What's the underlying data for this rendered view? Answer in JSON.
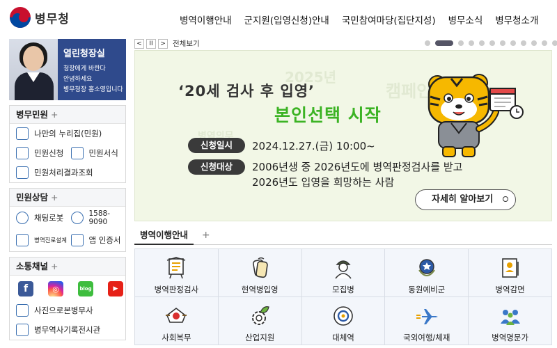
{
  "header": {
    "logo_text": "병무청",
    "nav": [
      "병역이행안내",
      "군지원(입영신청)안내",
      "국민참여마당(집단지성)",
      "병무소식",
      "병무청소개"
    ]
  },
  "ceo": {
    "title": "열린청장실",
    "sub": [
      "청장에게 바란다",
      "안녕하세요",
      "병무청장 홍소영입니다"
    ]
  },
  "civil": {
    "title": "병무민원",
    "plus": "+",
    "items": {
      "home": "나만의 누리집(민원)",
      "apply": "민원신청",
      "form": "민원서식",
      "result": "민원처리결과조회"
    }
  },
  "consult": {
    "title": "민원상담",
    "plus": "+",
    "chatbot": "채팅로봇",
    "phone": "1588-9090",
    "design": "병역진로설계",
    "app": "앱 인증서"
  },
  "sns": {
    "title": "소통채널",
    "plus": "+",
    "facebook": "f",
    "instagram": "◎",
    "blog": "blog",
    "youtube": "▶",
    "photo": "사진으로본병무사",
    "archive": "병무역사기록전시관"
  },
  "banner_controls": {
    "prev": "<",
    "pause": "II",
    "next": ">",
    "view_all": "전체보기",
    "dots": 14,
    "active_dot": 1
  },
  "banner": {
    "title": "‘20세 검사 후 입영’",
    "main": "본인선택 시작",
    "label1": "신청일시",
    "line1": "2024.12.27.(금) 10:00~",
    "label2": "신청대상",
    "line2a": "2006년생 중 2026년도에 병역판정검사를 받고",
    "line2b": "2026년도 입영을 희망하는 사람",
    "more": "자세히 알아보기"
  },
  "section": {
    "tab": "병역이행안내",
    "plus": "+"
  },
  "grid": [
    {
      "label": "병역판정검사",
      "icon": "exam-board-icon"
    },
    {
      "label": "현역병입영",
      "icon": "dog-tag-icon"
    },
    {
      "label": "모집병",
      "icon": "soldier-icon"
    },
    {
      "label": "동원예비군",
      "icon": "reserve-emblem-icon"
    },
    {
      "label": "병역감면",
      "icon": "document-person-icon"
    },
    {
      "label": "사회복무",
      "icon": "service-emblem-icon"
    },
    {
      "label": "산업지원",
      "icon": "gear-leaf-icon"
    },
    {
      "label": "대체역",
      "icon": "alternative-service-icon"
    },
    {
      "label": "국외여행/체재",
      "icon": "airplane-icon"
    },
    {
      "label": "병역명문가",
      "icon": "family-icon"
    }
  ],
  "colors": {
    "banner_bg": "#f2f7e6",
    "accent_green": "#3cb324",
    "ceo_bg": "#2f4a8c",
    "grid_bg": "#f3f6fb"
  }
}
